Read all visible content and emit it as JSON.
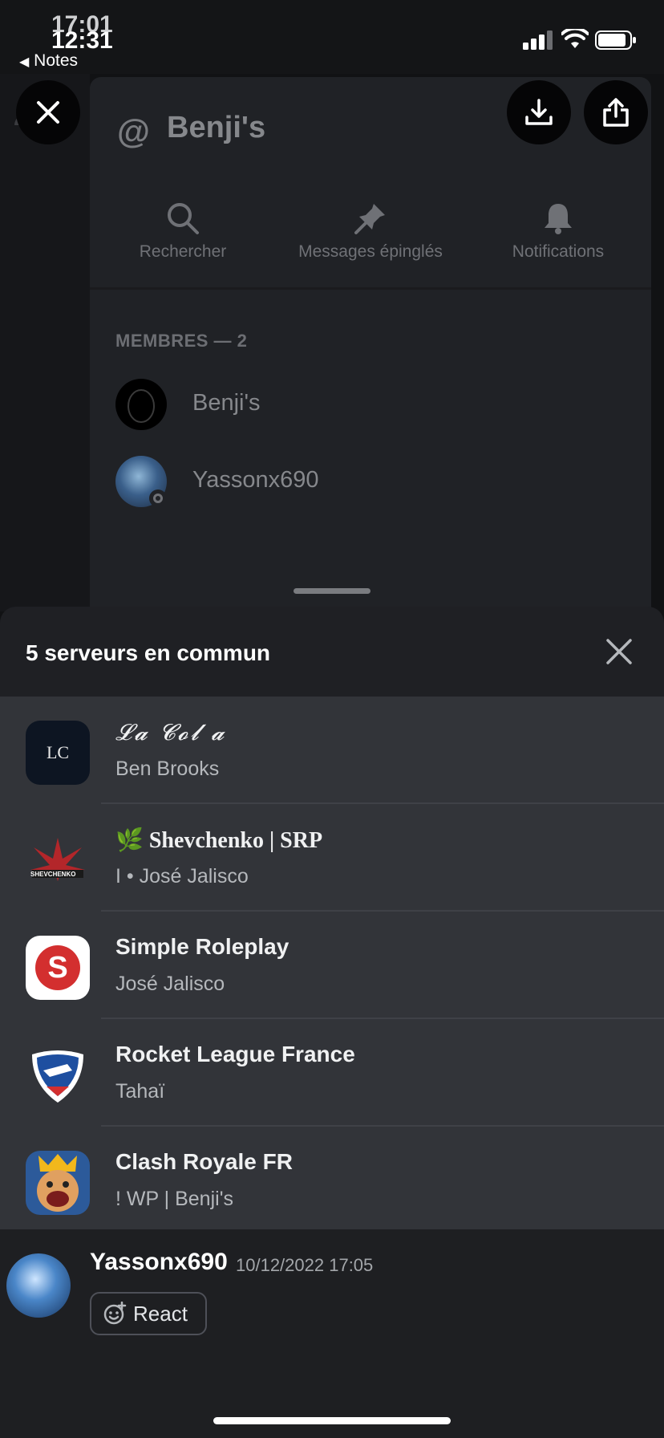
{
  "status_bar": {
    "time_back": "17:01",
    "time_front": "12:31",
    "back_app": "Notes"
  },
  "channel": {
    "at_symbol": "@",
    "title": "Benji's",
    "tools": [
      {
        "label": "Rechercher",
        "icon": "search-icon"
      },
      {
        "label": "Messages épinglés",
        "icon": "pin-icon"
      },
      {
        "label": "Notifications",
        "icon": "bell-icon"
      }
    ],
    "members_header": "MEMBRES — 2",
    "members": [
      {
        "name": "Benji's"
      },
      {
        "name": "Yassonx690"
      }
    ]
  },
  "sheet": {
    "title": "5 serveurs en commun",
    "servers": [
      {
        "name": "𝓛𝓪 𝓒𝓸𝓵 𝓪",
        "nick": "Ben Brooks",
        "icon_text": "LC"
      },
      {
        "name": "🌿 Shevchenko | SRP",
        "nick": "I • José Jalisco",
        "icon_text": "SHEVCHENKO"
      },
      {
        "name": "Simple Roleplay",
        "nick": "José Jalisco",
        "icon_text": "S"
      },
      {
        "name": "Rocket League France",
        "nick": "Tahaï"
      },
      {
        "name": "Clash Royale FR",
        "nick": "! WP | Benji's"
      }
    ]
  },
  "message": {
    "author": "Yassonx690",
    "timestamp": "10/12/2022 17:05",
    "react_label": "React"
  },
  "colors": {
    "panel": "#202226",
    "sheet": "#1f2024",
    "list": "#323439",
    "accent_red": "#c62828"
  }
}
